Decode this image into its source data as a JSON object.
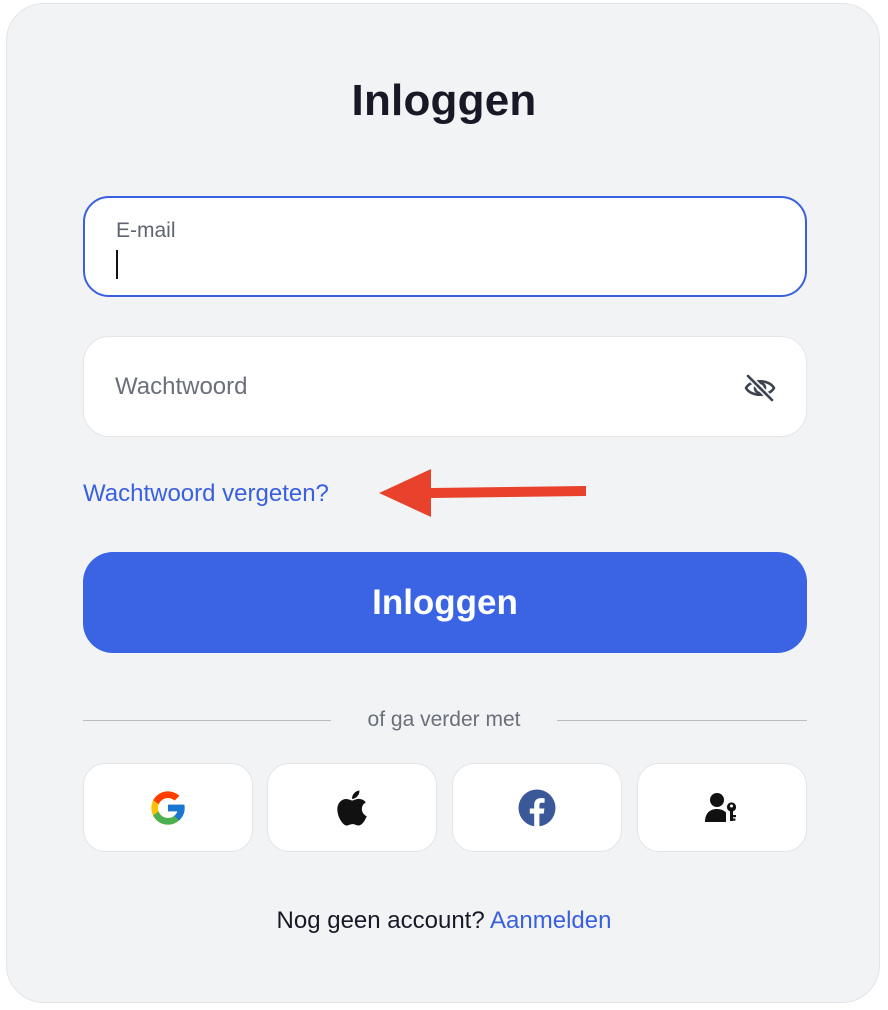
{
  "title": "Inloggen",
  "email_field": {
    "label": "E-mail",
    "value": ""
  },
  "password_field": {
    "placeholder": "Wachtwoord",
    "toggle_icon": "eye-slash-icon"
  },
  "forgot_password_link": "Wachtwoord vergeten?",
  "annotation": {
    "icon": "red-arrow-left",
    "color": "#e8412c"
  },
  "login_button": "Inloggen",
  "divider_text": "of ga verder met",
  "social_buttons": [
    {
      "icon": "google-icon"
    },
    {
      "icon": "apple-icon"
    },
    {
      "icon": "facebook-icon"
    },
    {
      "icon": "passkey-icon"
    }
  ],
  "footer": {
    "prompt": "Nog geen account?",
    "signup_link": "Aanmelden"
  },
  "colors": {
    "accent": "#3a64e3",
    "link": "#3a60dd",
    "card_background": "#f2f3f5",
    "text": "#171a26"
  }
}
